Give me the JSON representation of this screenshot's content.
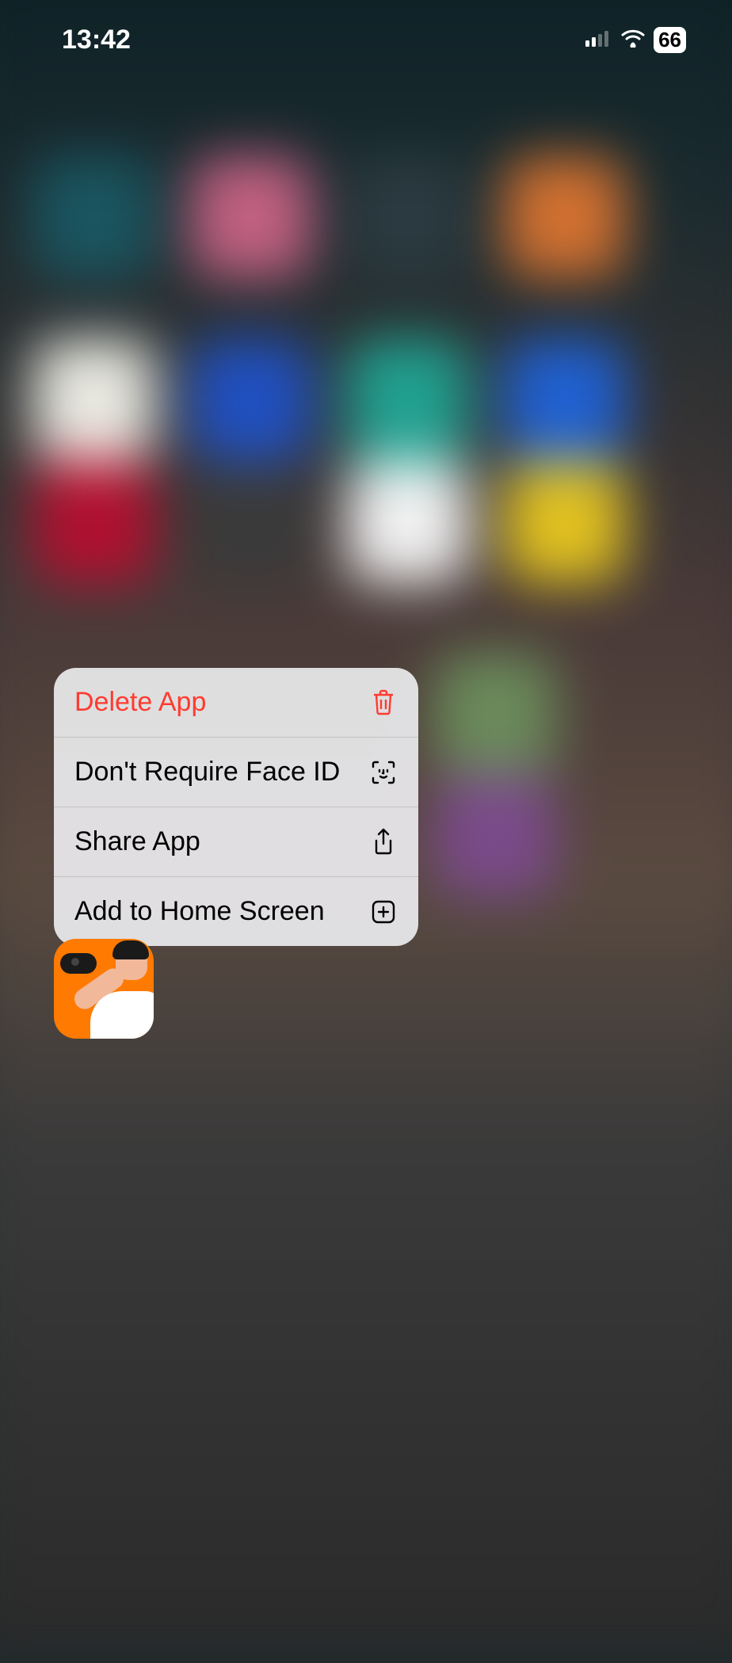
{
  "status": {
    "time": "13:42",
    "battery": "66"
  },
  "menu": {
    "delete": "Delete App",
    "faceid": "Don't Require Face ID",
    "share": "Share App",
    "addhome": "Add to Home Screen"
  },
  "app": {
    "selected": "fitness-app"
  },
  "icons": {
    "trash": "trash-icon",
    "faceid": "faceid-icon",
    "share": "share-icon",
    "plus": "plus-square-icon"
  }
}
